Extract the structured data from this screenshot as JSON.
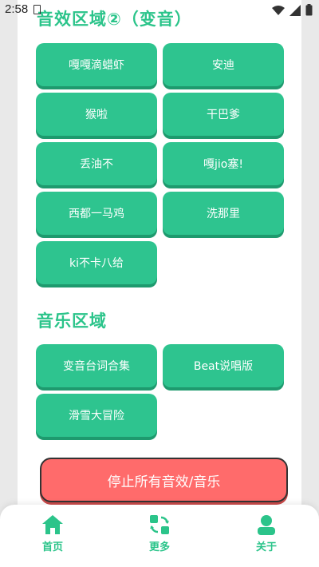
{
  "status_bar": {
    "time": "2:58",
    "icons": [
      "notification-icon",
      "wifi-icon",
      "signal-icon",
      "battery-icon"
    ]
  },
  "sections": {
    "sfx_title": "音效区域②（变音）",
    "music_title": "音乐区域"
  },
  "sfx_buttons": [
    "嘎嘎滴蜡虾",
    "安迪",
    "猴啦",
    "干巴爹",
    "丢油不",
    "嘎jio塞!",
    "西都一马鸡",
    "洗那里",
    "ki不卡八给"
  ],
  "music_buttons": [
    "变音台词合集",
    "Beat说唱版",
    "滑雪大冒险"
  ],
  "stop_button": "停止所有音效/音乐",
  "bottom_nav": [
    {
      "label": "首页",
      "icon": "home-icon"
    },
    {
      "label": "更多",
      "icon": "more-icon"
    },
    {
      "label": "关于",
      "icon": "user-icon"
    }
  ],
  "colors": {
    "accent": "#2bc48a",
    "button": "#2ec48f",
    "stop": "#ff6b6b"
  }
}
